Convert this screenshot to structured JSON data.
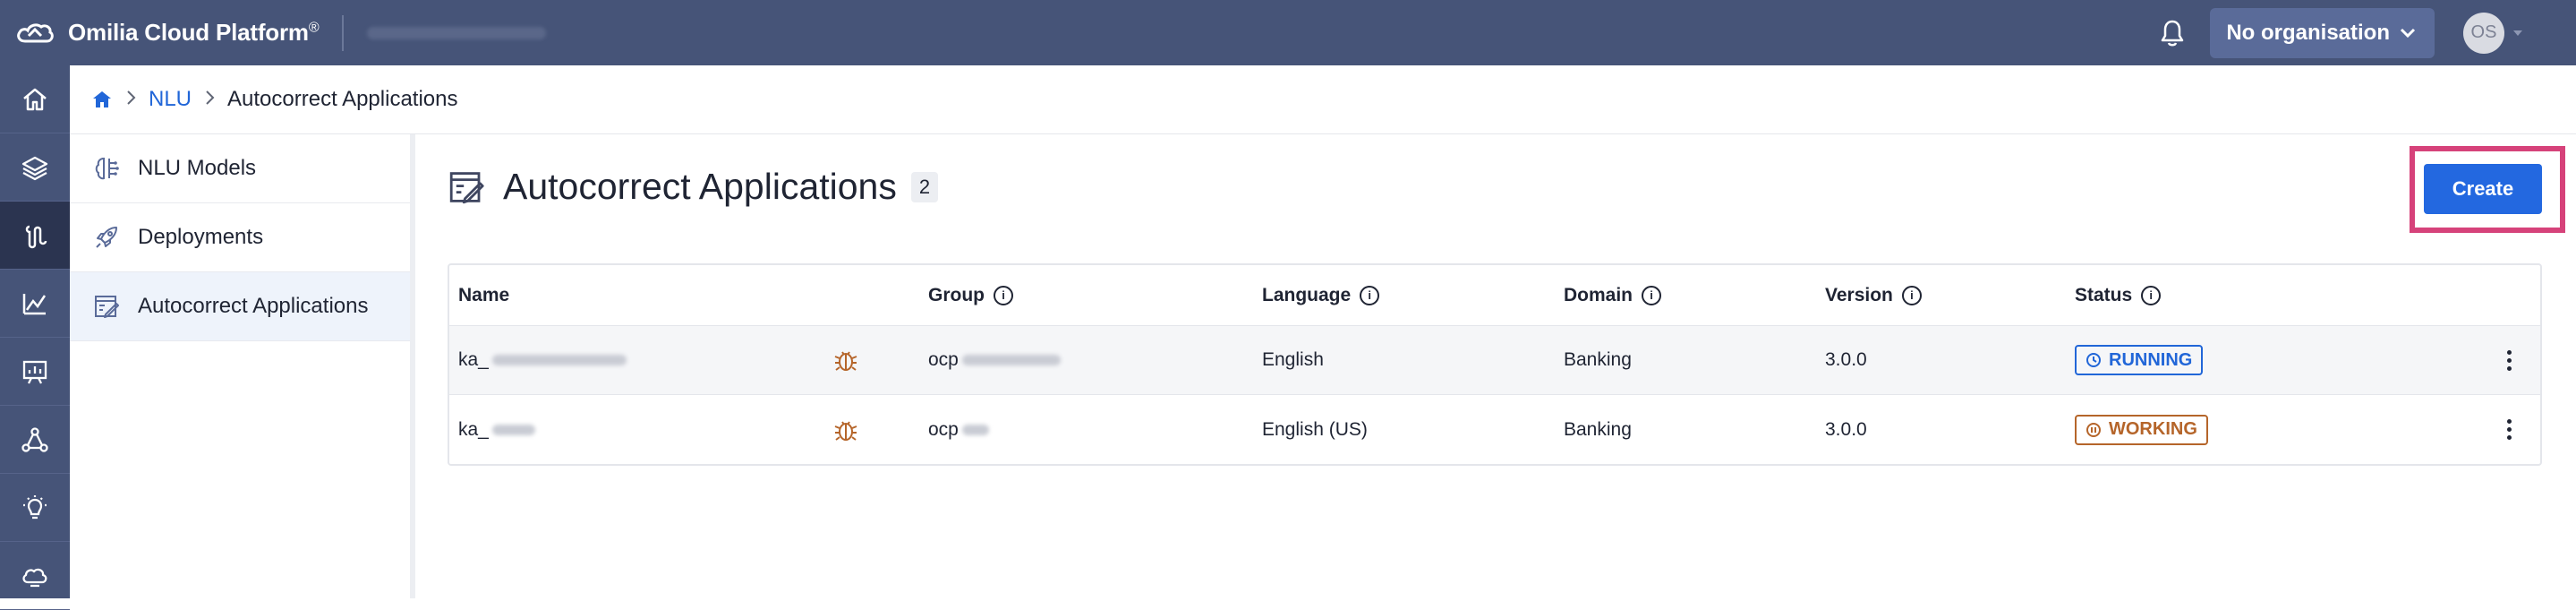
{
  "topbar": {
    "brand": "Omilia Cloud Platform",
    "brand_mark": "®",
    "organisation": "No organisation",
    "avatar_initials": "OS"
  },
  "rail": {
    "items": [
      {
        "icon": "home-icon"
      },
      {
        "icon": "layers-icon"
      },
      {
        "icon": "nlu-icon",
        "active": true
      },
      {
        "icon": "analytics-icon"
      },
      {
        "icon": "presentation-icon"
      },
      {
        "icon": "network-icon"
      },
      {
        "icon": "lightbulb-icon"
      },
      {
        "icon": "cloud-icon"
      }
    ]
  },
  "breadcrumb": {
    "home_icon": "home-icon",
    "items": [
      "NLU",
      "Autocorrect Applications"
    ]
  },
  "subnav": {
    "items": [
      {
        "label": "NLU Models",
        "icon": "brain-icon"
      },
      {
        "label": "Deployments",
        "icon": "rocket-icon"
      },
      {
        "label": "Autocorrect Applications",
        "icon": "autocorrect-icon",
        "active": true
      }
    ]
  },
  "main": {
    "title": "Autocorrect Applications",
    "count": "2",
    "create_label": "Create"
  },
  "table": {
    "columns": [
      "Name",
      "Group",
      "Language",
      "Domain",
      "Version",
      "Status"
    ],
    "rows": [
      {
        "name": "ka_",
        "group": "ocp",
        "language": "English",
        "domain": "Banking",
        "version": "3.0.0",
        "status": "RUNNING"
      },
      {
        "name": "ka_",
        "group": "ocp",
        "language": "English (US)",
        "domain": "Banking",
        "version": "3.0.0",
        "status": "WORKING"
      }
    ]
  },
  "colors": {
    "topbar": "#465478",
    "accent": "#2368e0",
    "running": "#2166d8",
    "working": "#b5652a",
    "highlight": "#d6427a"
  }
}
